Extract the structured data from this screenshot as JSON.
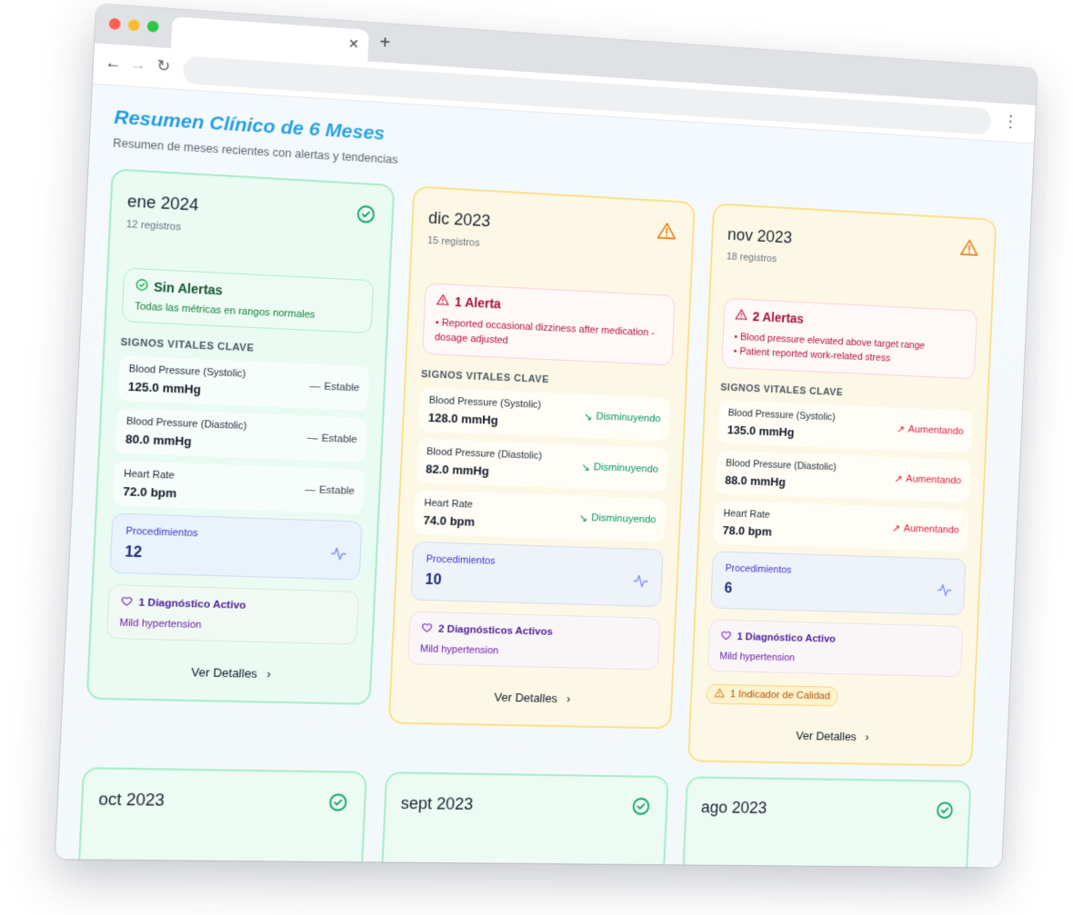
{
  "page": {
    "title": "Resumen Clínico de 6 Meses",
    "subtitle": "Resumen de meses recientes con alertas y tendencias",
    "section_label": "SIGNOS VITALES CLAVE",
    "details_label": "Ver Detalles",
    "proc_label": "Procedimientos"
  },
  "months": [
    {
      "month": "ene 2024",
      "count": "12 registros",
      "alert_title": "Sin Alertas",
      "alert_sub": "Todas las métricas en rangos normales",
      "vitals": [
        {
          "name": "Blood Pressure (Systolic)",
          "value": "125.0 mmHg",
          "trend": "Estable"
        },
        {
          "name": "Blood Pressure (Diastolic)",
          "value": "80.0 mmHg",
          "trend": "Estable"
        },
        {
          "name": "Heart Rate",
          "value": "72.0 bpm",
          "trend": "Estable"
        }
      ],
      "procedures": "12",
      "diagnosis_title": "1 Diagnóstico Activo",
      "diagnosis_text": "Mild hypertension"
    },
    {
      "month": "dic 2023",
      "count": "15 registros",
      "alert_title": "1 Alerta",
      "alerts": [
        "• Reported occasional dizziness after medication - dosage adjusted"
      ],
      "vitals": [
        {
          "name": "Blood Pressure (Systolic)",
          "value": "128.0 mmHg",
          "trend": "Disminuyendo"
        },
        {
          "name": "Blood Pressure (Diastolic)",
          "value": "82.0 mmHg",
          "trend": "Disminuyendo"
        },
        {
          "name": "Heart Rate",
          "value": "74.0 bpm",
          "trend": "Disminuyendo"
        }
      ],
      "procedures": "10",
      "diagnosis_title": "2 Diagnósticos Activos",
      "diagnosis_text": "Mild hypertension"
    },
    {
      "month": "nov 2023",
      "count": "18 registros",
      "alert_title": "2 Alertas",
      "alerts": [
        "• Blood pressure elevated above target range",
        "• Patient reported work-related stress"
      ],
      "vitals": [
        {
          "name": "Blood Pressure (Systolic)",
          "value": "135.0 mmHg",
          "trend": "Aumentando"
        },
        {
          "name": "Blood Pressure (Diastolic)",
          "value": "88.0 mmHg",
          "trend": "Aumentando"
        },
        {
          "name": "Heart Rate",
          "value": "78.0 bpm",
          "trend": "Aumentando"
        }
      ],
      "procedures": "6",
      "diagnosis_title": "1 Diagnóstico Activo",
      "diagnosis_text": "Mild hypertension",
      "quality": "1 Indicador de Calidad"
    }
  ],
  "next_months": [
    "oct 2023",
    "sept 2023",
    "ago 2023"
  ],
  "colors": {
    "ok_border": "#a7ecc9",
    "warn_border": "#fbe08a",
    "up": "#e11d48",
    "down": "#059669",
    "title": "#2aa3e6"
  }
}
